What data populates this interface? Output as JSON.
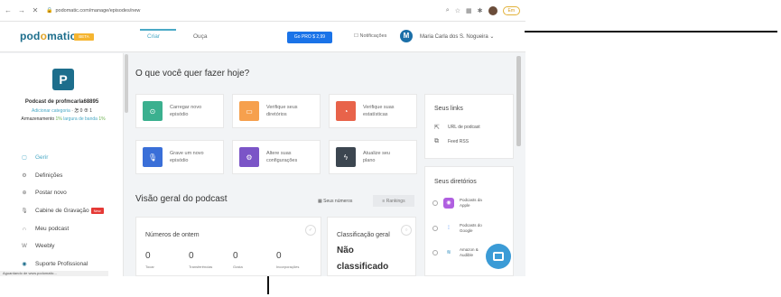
{
  "browser": {
    "url": "podomatic.com/manage/episodes/new",
    "profile_label": "Em"
  },
  "header": {
    "logo_text_1": "pod",
    "logo_text_2": "o",
    "logo_text_3": "matic",
    "beta_label": "BETA",
    "tabs": [
      {
        "label": "Criar",
        "active": true
      },
      {
        "label": "Ouça",
        "active": false
      }
    ],
    "go_pro_label": "Go PRO $ 2,99",
    "notifications_label": "Notificações",
    "user_initial": "M",
    "user_name": "Maria Carla dos S. Nogueira ⌄"
  },
  "sidebar": {
    "podcast_logo_letter": "P",
    "podcast_name": "Podcast de profmcarla68895",
    "category_link": "Adicionar categoria",
    "category_stats": " · 怎 0 ⊕ 1",
    "storage_label": "Armazenamento",
    "storage_value": "1%",
    "bandwidth_label": "largura de banda",
    "bandwidth_value": "1%",
    "items": [
      {
        "label": "Gerir",
        "icon": "square-icon",
        "active": true
      },
      {
        "label": "Definições",
        "icon": "gear-icon",
        "active": false
      },
      {
        "label": "Postar novo",
        "icon": "plus-circle-icon",
        "active": false
      },
      {
        "label": "Cabine de Gravação",
        "icon": "mic-icon",
        "active": false,
        "badge": "New"
      },
      {
        "label": "Meu podcast",
        "icon": "headphones-icon",
        "active": false
      },
      {
        "label": "Weebly",
        "icon": "weebly-icon",
        "active": false
      },
      {
        "label": "Suporte Profissional",
        "icon": "help-icon",
        "active": false
      }
    ],
    "status_text": "Aguardando de www.podomatic..."
  },
  "main": {
    "title": "O que você quer fazer hoje?",
    "cards": [
      {
        "line1": "Carregar novo",
        "line2": "episódio",
        "color": "#3bb08f",
        "icon": "play-icon"
      },
      {
        "line1": "Verifique seus",
        "line2": "diretórios",
        "color": "#f6a04d",
        "icon": "folder-icon"
      },
      {
        "line1": "Verifique suas",
        "line2": "estatísticas",
        "color": "#e8634a",
        "icon": "stats-icon"
      },
      {
        "line1": "Grave um novo",
        "line2": "episódio",
        "color": "#3a6fd8",
        "icon": "mic-icon"
      },
      {
        "line1": "Altere suas",
        "line2": "configurações",
        "color": "#7b55c7",
        "icon": "settings-icon"
      },
      {
        "line1": "Atualize seu",
        "line2": "plano",
        "color": "#3c4650",
        "icon": "bolt-icon"
      }
    ],
    "overview_title": "Visão geral do podcast",
    "seus_numeros_label": "Seus números",
    "rankings_label": "Rankings",
    "yesterday": {
      "title": "Números de ontem",
      "stats": [
        {
          "value": "0",
          "label": "Tocar"
        },
        {
          "value": "0",
          "label": "Transferências"
        },
        {
          "value": "0",
          "label": "Gosta"
        },
        {
          "value": "0",
          "label": "Incorporações"
        }
      ]
    },
    "classification": {
      "title": "Classificação geral",
      "value_line1": "Não",
      "value_line2": "classificado"
    }
  },
  "right_panel": {
    "links_title": "Seus links",
    "links": [
      {
        "label": "URL de podcast",
        "icon": "external-link-icon"
      },
      {
        "label": "Feed RSS",
        "icon": "copy-icon"
      }
    ],
    "directories_title": "Seus diretórios",
    "directories": [
      {
        "line1": "Podcasts da",
        "line2": "Apple",
        "color": "#b05fe0",
        "icon": "apple-podcasts-icon"
      },
      {
        "line1": "Podcasts do",
        "line2": "Google",
        "color": "#ffffff",
        "icon": "google-podcasts-icon"
      },
      {
        "line1": "Amazon &",
        "line2": "Audible",
        "color": "#ffffff",
        "icon": "amazon-icon"
      }
    ]
  }
}
